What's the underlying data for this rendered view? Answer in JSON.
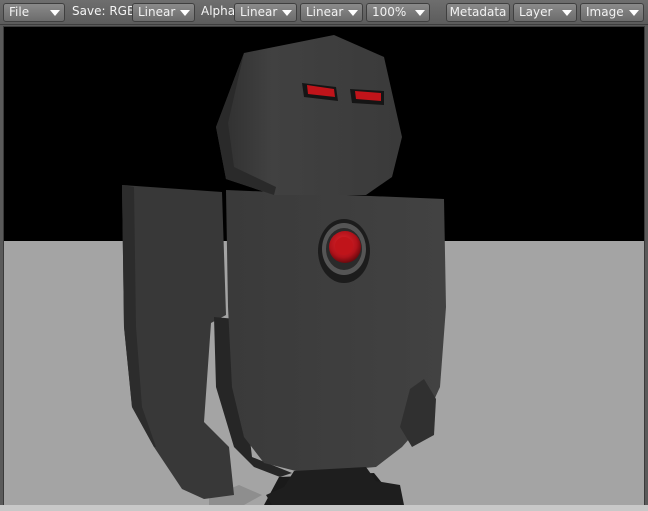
{
  "toolbar": {
    "file_label": "File",
    "save_label": "Save: RGB",
    "save_mode": "Linear",
    "alpha_label": "Alpha",
    "alpha_mode": "Linear",
    "color_space": "Linear",
    "zoom": "100%",
    "metadata_label": "Metadata",
    "layer_label": "Layer",
    "image_label": "Image"
  },
  "render": {
    "background_color": "#000000",
    "floor_color": "#a4a4a4",
    "robot_color": "#3b3b3b",
    "accent_color": "#c0141a"
  },
  "icons": {
    "dropdown": "chevron-down-icon"
  }
}
